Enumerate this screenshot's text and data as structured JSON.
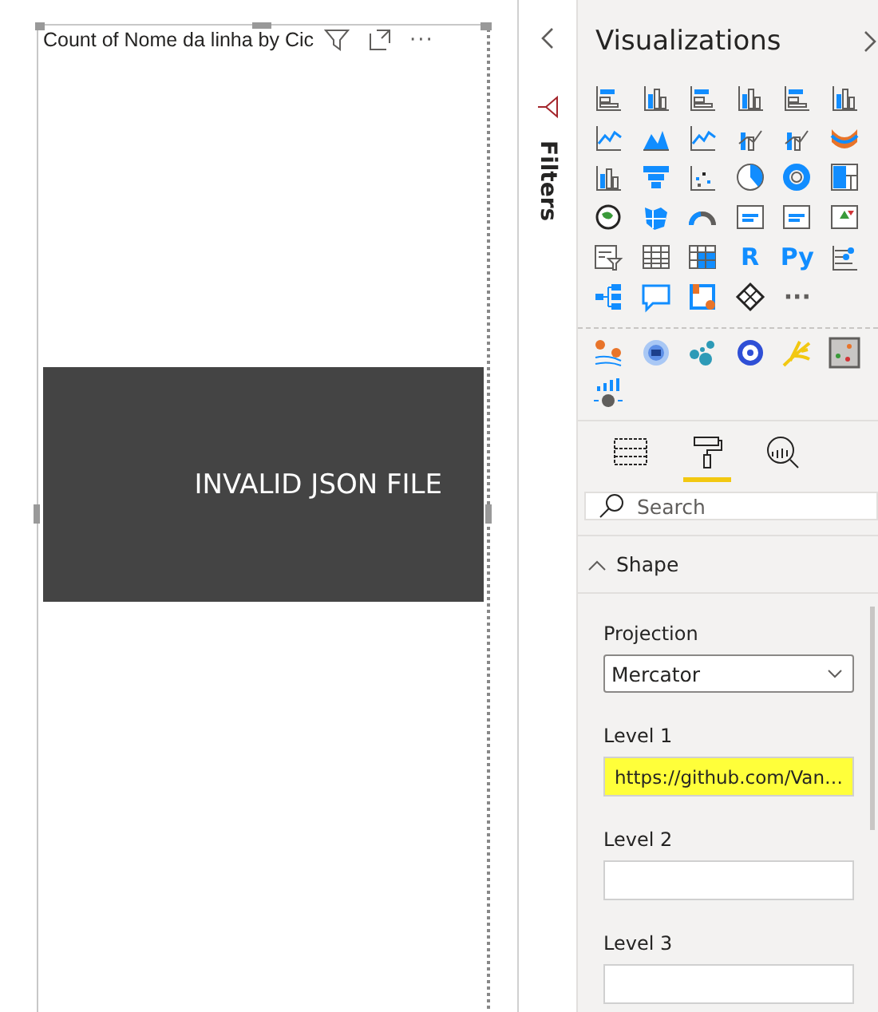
{
  "visual": {
    "title": "Count of Nome da linha by Cic",
    "more": "···",
    "error": "INVALID JSON FILE"
  },
  "filters_pane": {
    "label": "Filters"
  },
  "visualizations": {
    "title": "Visualizations",
    "text_tiles": [
      "R",
      "Py",
      "···"
    ],
    "tabs": [
      {
        "kind": "fields",
        "selected": false
      },
      {
        "kind": "format",
        "selected": true
      },
      {
        "kind": "analytics",
        "selected": false
      }
    ],
    "search": {
      "placeholder": "Search"
    },
    "section": {
      "title": "Shape",
      "expanded": true
    },
    "fields": [
      {
        "label": "Projection",
        "kind": "dropdown",
        "value": "Mercator"
      },
      {
        "label": "Level 1",
        "kind": "text",
        "value": "https://github.com/Van…",
        "highlighted": true
      },
      {
        "label": "Level 2",
        "kind": "text",
        "highlighted": false
      },
      {
        "label": "Level 3",
        "kind": "text",
        "highlighted": false
      }
    ]
  }
}
